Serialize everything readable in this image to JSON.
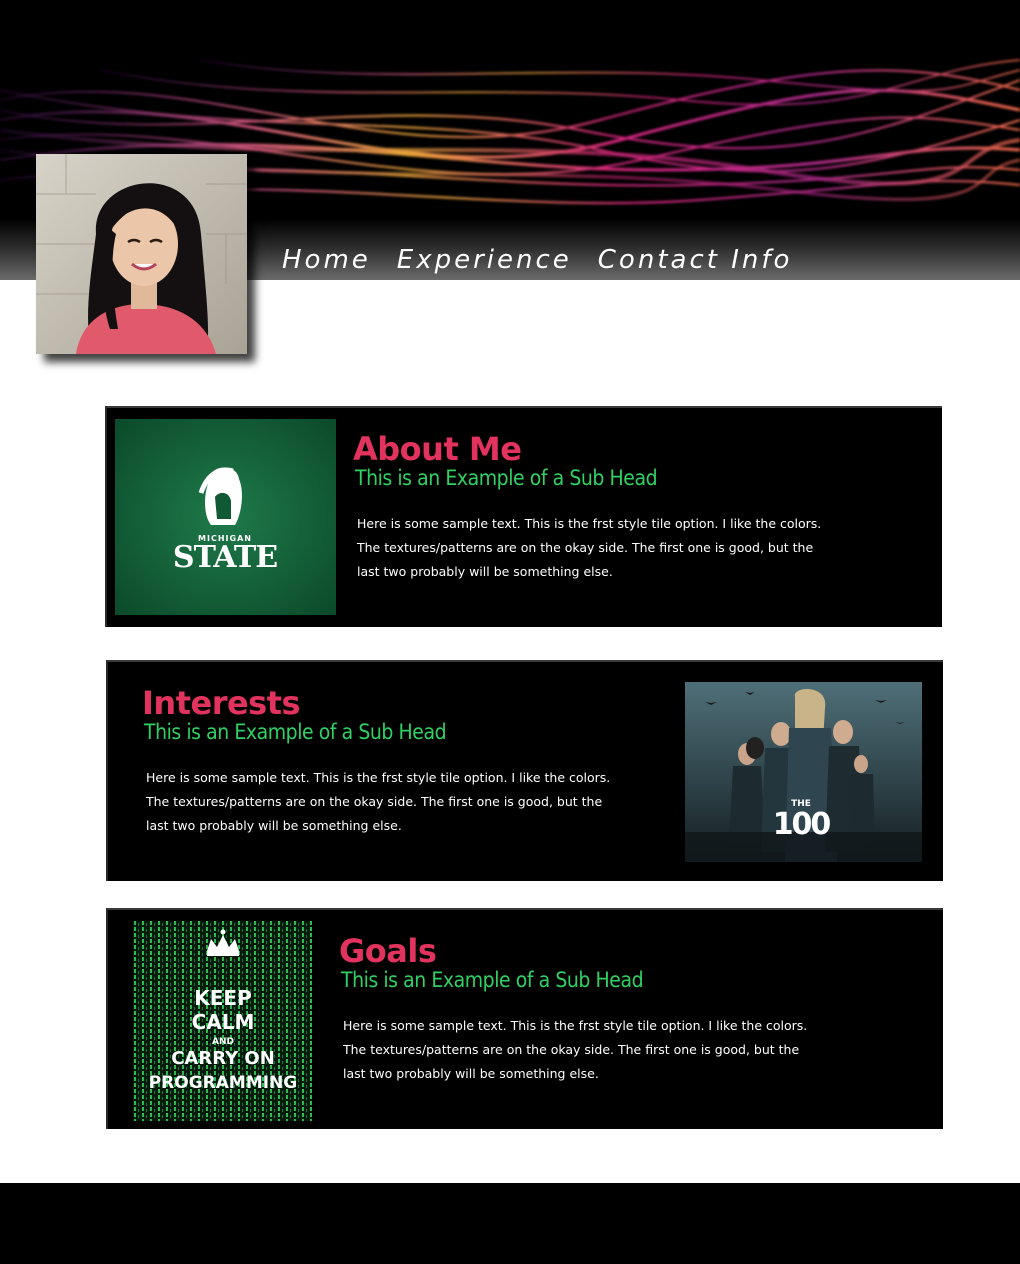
{
  "nav": {
    "items": [
      "Home",
      "Experience",
      "Contact Info"
    ]
  },
  "colors": {
    "title": "#e2335e",
    "subhead": "#2fd164",
    "tile_bg": "#000000",
    "page_bg": "#ffffff"
  },
  "sections": {
    "about": {
      "title": "About Me",
      "subhead": "This is an Example of a Sub Head",
      "body": "Here is some sample text. This is the frst style tile option. I like the colors. The textures/patterns are on the okay side. The first one is good, but the last two probably will be something else.",
      "image": {
        "name": "michigan-state-logo",
        "small_text": "MICHIGAN",
        "big_text": "STATE"
      }
    },
    "interests": {
      "title": "Interests",
      "subhead": "This is an Example of a Sub Head",
      "body": "Here is some sample text. This is the frst style tile option. I like the colors. The textures/patterns are on the okay side. The first one is good, but the last two probably will be something else.",
      "image": {
        "name": "the-100-poster",
        "small_text": "THE",
        "big_text": "100"
      }
    },
    "goals": {
      "title": "Goals",
      "subhead": "This is an Example of a Sub Head",
      "body": "Here is some sample text. This is the frst style tile option. I like the colors. The textures/patterns are on the okay side. The first one is good, but the last two probably will be something else.",
      "image": {
        "name": "keep-calm-poster",
        "lines": [
          "KEEP",
          "CALM",
          "AND",
          "CARRY ON",
          "PROGRAMMING"
        ]
      }
    }
  }
}
